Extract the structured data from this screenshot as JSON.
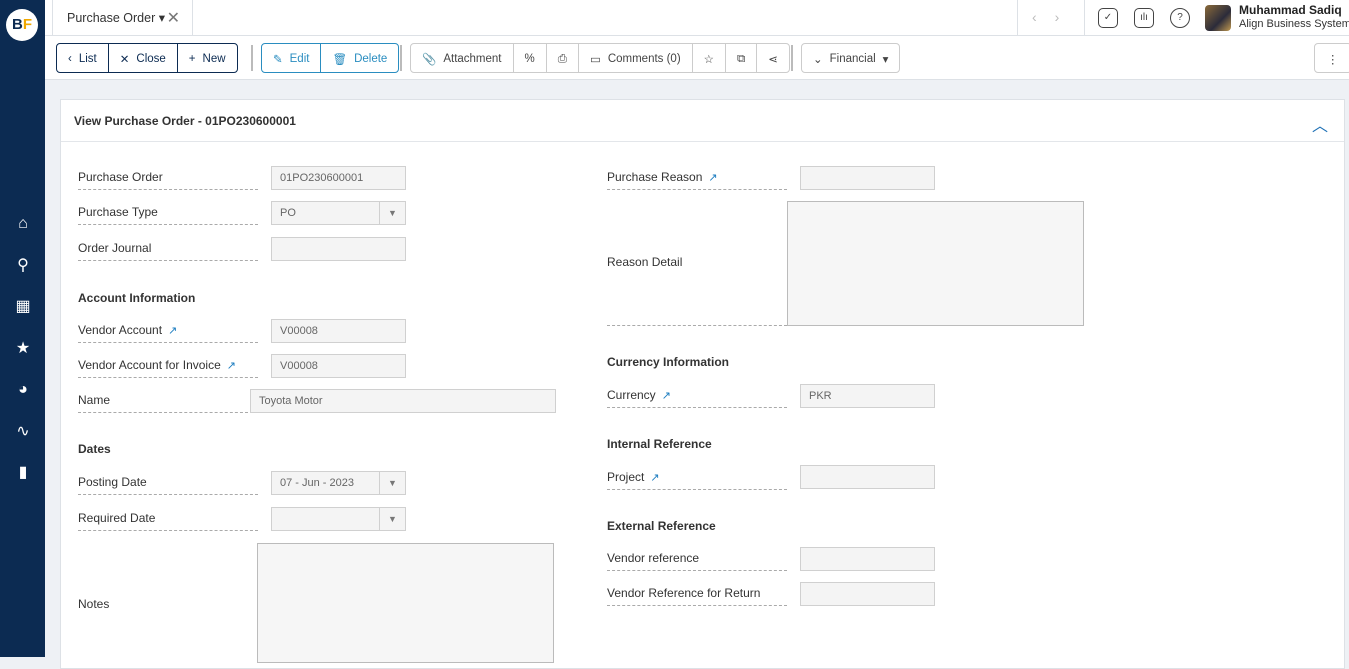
{
  "app": {
    "logo": "BF",
    "tab": "Purchase Order",
    "nav": [
      "‹",
      "›"
    ]
  },
  "user": {
    "name": "Muhammad Sadiq",
    "company": "Align Business Systems"
  },
  "toolbar": {
    "list": "List",
    "close": "Close",
    "new": "New",
    "edit": "Edit",
    "delete": "Delete",
    "attachment": "Attachment",
    "percent": "%",
    "comments": "Comments (0)",
    "financial": "Financial"
  },
  "panel": {
    "title": "View Purchase Order - 01PO230600001"
  },
  "form": {
    "purchase_order": {
      "label": "Purchase Order",
      "value": "01PO230600001"
    },
    "purchase_type": {
      "label": "Purchase Type",
      "value": "PO"
    },
    "order_journal": {
      "label": "Order Journal",
      "value": ""
    },
    "account_info": "Account Information",
    "vendor_account": {
      "label": "Vendor Account",
      "value": "V00008"
    },
    "vendor_account_invoice": {
      "label": "Vendor Account for Invoice",
      "value": "V00008"
    },
    "name": {
      "label": "Name",
      "value": "Toyota Motor"
    },
    "dates": "Dates",
    "posting_date": {
      "label": "Posting Date",
      "value": "07 - Jun - 2023"
    },
    "required_date": {
      "label": "Required Date",
      "value": ""
    },
    "notes": {
      "label": "Notes"
    },
    "purchase_reason": {
      "label": "Purchase Reason",
      "value": ""
    },
    "reason_detail": {
      "label": "Reason Detail"
    },
    "currency_info": "Currency Information",
    "currency": {
      "label": "Currency",
      "value": "PKR"
    },
    "internal_ref": "Internal Reference",
    "project": {
      "label": "Project",
      "value": ""
    },
    "external_ref": "External Reference",
    "vendor_reference": {
      "label": "Vendor reference",
      "value": ""
    },
    "vendor_reference_return": {
      "label": "Vendor Reference for Return",
      "value": ""
    }
  }
}
